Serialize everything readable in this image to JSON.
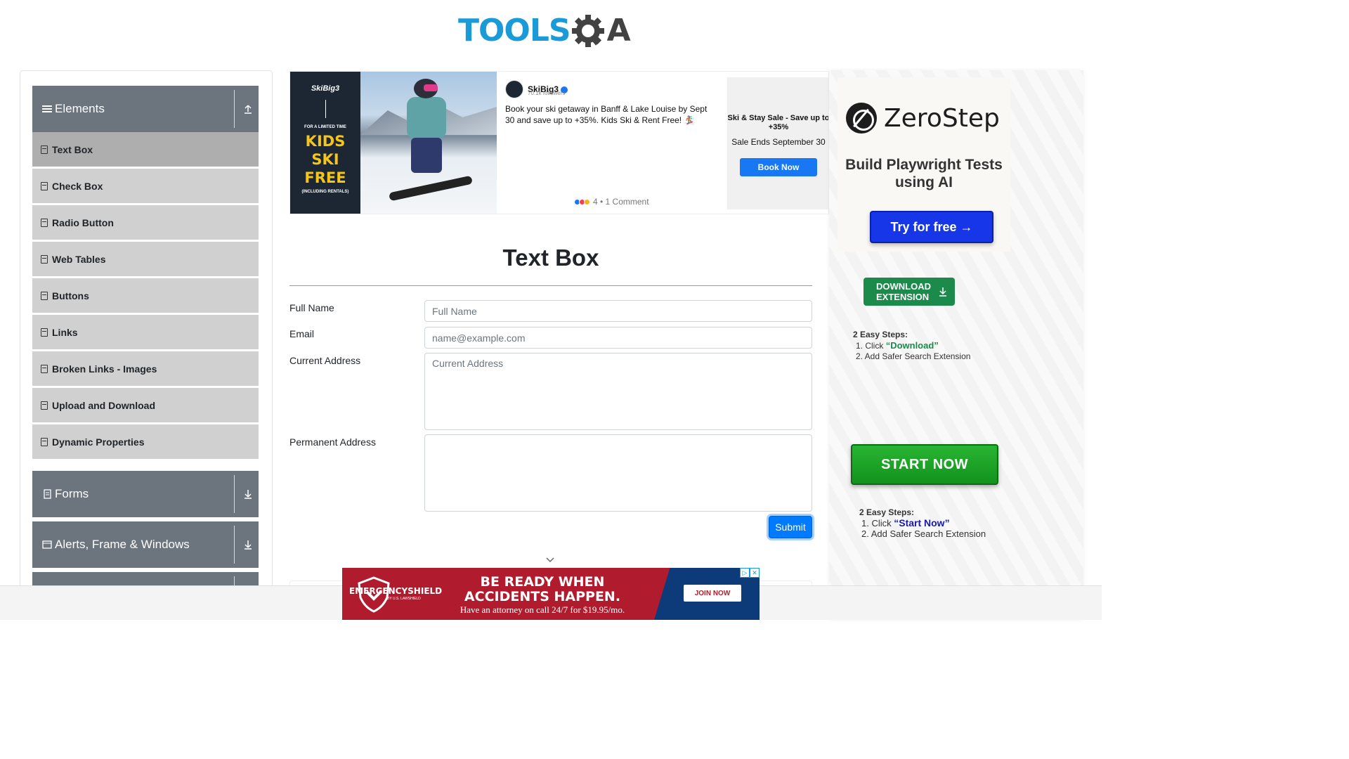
{
  "header": {
    "logo_tools": "TOOLS",
    "logo_qa": "QA"
  },
  "sidebar": {
    "groups": [
      {
        "label": "Elements",
        "icon": "hamburger-icon",
        "state": "expanded"
      },
      {
        "label": "Forms",
        "icon": "file-icon",
        "state": "collapsed"
      },
      {
        "label": "Alerts, Frame & Windows",
        "icon": "window-icon",
        "state": "collapsed"
      }
    ],
    "items": [
      {
        "label": "Text Box",
        "active": true
      },
      {
        "label": "Check Box"
      },
      {
        "label": "Radio Button"
      },
      {
        "label": "Web Tables"
      },
      {
        "label": "Buttons"
      },
      {
        "label": "Links"
      },
      {
        "label": "Broken Links - Images"
      },
      {
        "label": "Upload and Download"
      },
      {
        "label": "Dynamic Properties"
      }
    ]
  },
  "top_ad": {
    "brand": "SkiBig3",
    "limited": "FOR A LIMITED TIME",
    "headline": "KIDS SKI FREE",
    "including": "(INCLUDING RENTALS)",
    "followers": "70.1k followers",
    "body": "Book your ski getaway in Banff & Lake Louise by Sept 30 and save up to +35%. Kids Ski & Rent Free! 🏂",
    "reactions": "4 • 1 Comment",
    "offer_title": "Ski & Stay Sale - Save up to +35%",
    "offer_sub": "Sale Ends September 30",
    "cta": "Book Now"
  },
  "form": {
    "title": "Text Box",
    "full_name_label": "Full Name",
    "full_name_placeholder": "Full Name",
    "email_label": "Email",
    "email_placeholder": "name@example.com",
    "current_address_label": "Current Address",
    "current_address_placeholder": "Current Address",
    "permanent_address_label": "Permanent Address",
    "submit_label": "Submit"
  },
  "right_ad": {
    "brand": "ZeroStep",
    "tagline": "Build Playwright Tests using AI",
    "try_label": "Try for free →",
    "download_label": "DOWNLOAD EXTENSION",
    "steps1_title": "2 Easy Steps:",
    "steps1_item1_prefix": "1. Click ",
    "steps1_item1_highlight": "“Download”",
    "steps1_item2": "2. Add Safer Search Extension",
    "start_label": "START NOW",
    "steps2_title": "2 Easy Steps:",
    "steps2_item1_prefix": "1. Click ",
    "steps2_item1_highlight": "“Start Now”",
    "steps2_item2": "2. Add Safer Search Extension"
  },
  "bottom_ad": {
    "brand": "EMERGENCYSHIELD",
    "by": "BY U.S. LAWSHIELD",
    "headline": "BE READY WHEN ACCIDENTS HAPPEN.",
    "sub": "Have an attorney on call 24/7 for $19.95/mo.",
    "cta": "JOIN NOW"
  },
  "colors": {
    "sidebar_header": "#6c757d",
    "menu_item": "#d0d0d0",
    "menu_item_active": "#aeaeae",
    "submit": "#007bff",
    "logo_blue": "#1a9ad6"
  }
}
